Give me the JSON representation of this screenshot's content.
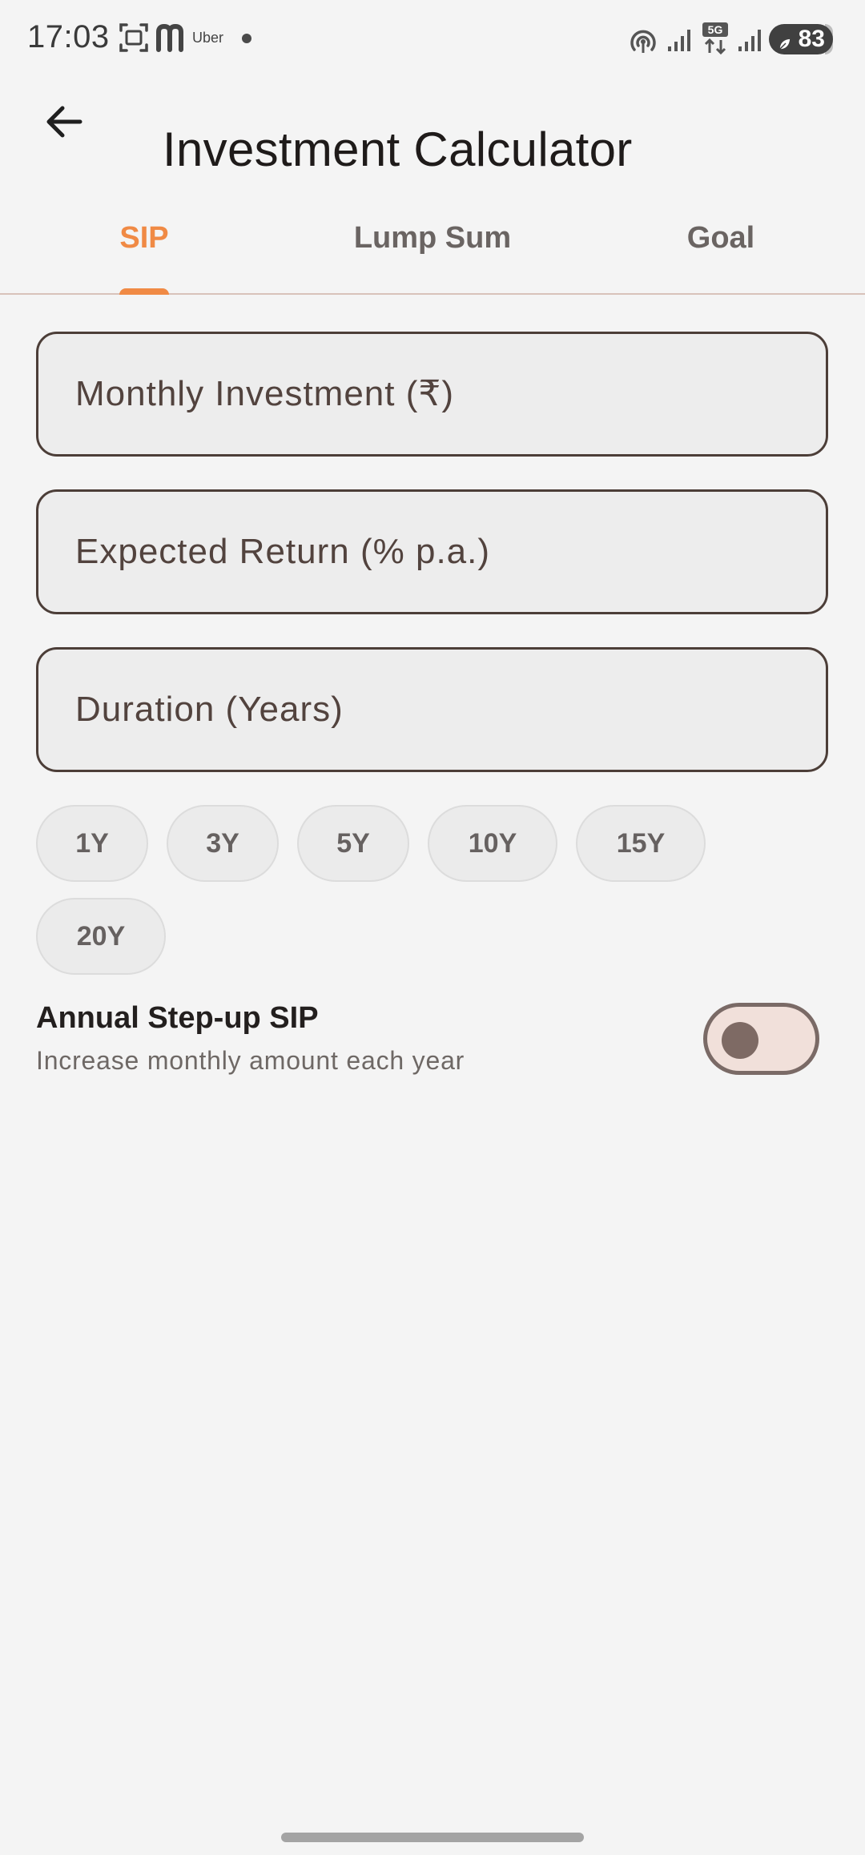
{
  "status_bar": {
    "time": "17:03",
    "app_text": "Uber",
    "battery": "83"
  },
  "header": {
    "title": "Investment Calculator",
    "back_icon": "arrow-left-icon"
  },
  "tabs": [
    {
      "label": "SIP",
      "active": true
    },
    {
      "label": "Lump Sum",
      "active": false
    },
    {
      "label": "Goal",
      "active": false
    }
  ],
  "form": {
    "monthly_investment": {
      "value": "",
      "placeholder": "Monthly Investment (₹)"
    },
    "expected_return": {
      "value": "",
      "placeholder": "Expected Return (% p.a.)"
    },
    "duration": {
      "value": "",
      "placeholder": "Duration (Years)"
    }
  },
  "duration_chips": [
    "1Y",
    "3Y",
    "5Y",
    "10Y",
    "15Y",
    "20Y"
  ],
  "step_up": {
    "title": "Annual Step-up SIP",
    "subtitle": "Increase monthly amount each year",
    "enabled": false
  },
  "colors": {
    "accent": "#f08a45",
    "background": "#f4f4f4",
    "field_border": "#4c3e38",
    "toggle_track": "#f1e0da"
  }
}
